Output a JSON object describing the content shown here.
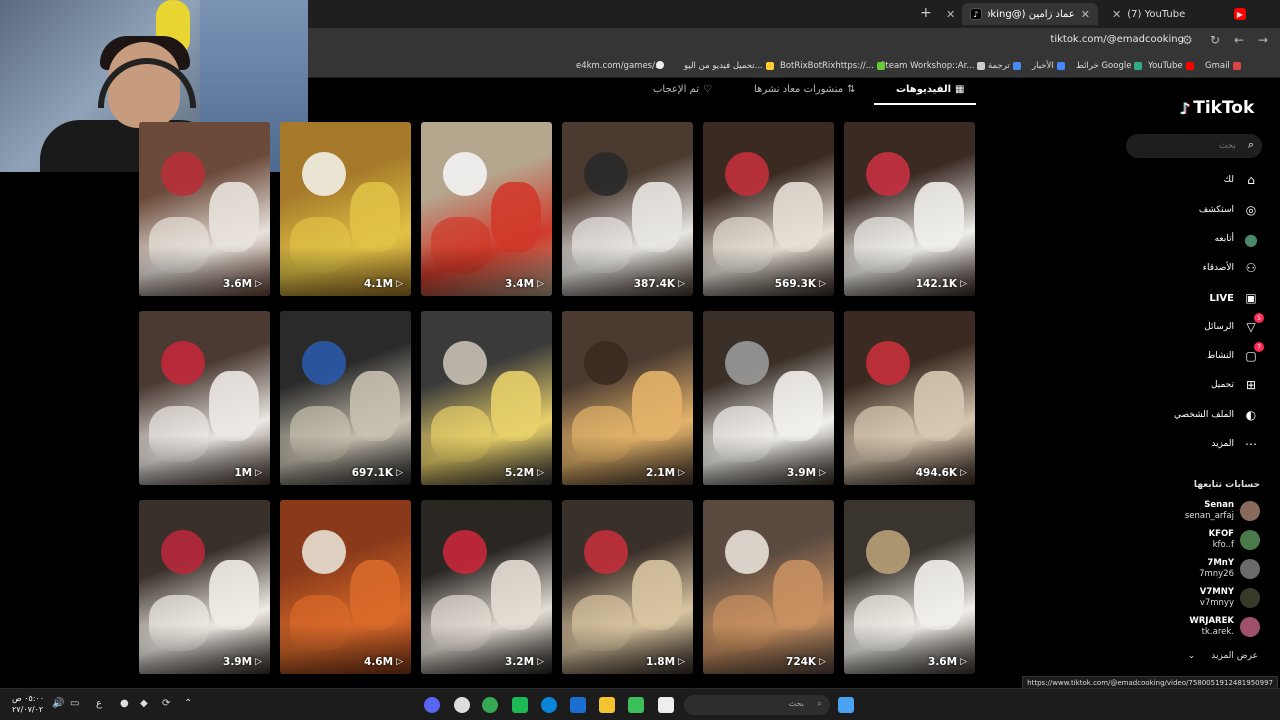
{
  "browser": {
    "tabs": [
      {
        "label": "(7) YouTube",
        "favicon_color": "#ff0000",
        "active": false
      },
      {
        "label": "عماد زامين (@emadcooking)",
        "favicon_color": "#000000",
        "active": true
      }
    ],
    "url": "tiktok.com/@emadcooking",
    "bookmarks": [
      "Gmail",
      "YouTube",
      "خرائط Google",
      "الأخبار",
      "ترجمة",
      "Steam Workshop::Ar...",
      "BotRixBotRixhttps://...",
      "تحميل فيديو من اليو...",
      "e4km.com/games/..."
    ]
  },
  "video_tabs": [
    {
      "label": "الفيديوهات",
      "icon": "grid-icon",
      "active": true
    },
    {
      "label": "منشورات معاد نشرها",
      "icon": "repost-icon",
      "active": false
    },
    {
      "label": "تم الإعجاب",
      "icon": "heart-icon",
      "active": false
    }
  ],
  "videos": [
    {
      "views": "3.6M",
      "c1": "#6b4a3a",
      "c2": "#e8e2dc",
      "c3": "#b8303a"
    },
    {
      "views": "4.1M",
      "c1": "#a67a2a",
      "c2": "#e0c246",
      "c3": "#f2efe6"
    },
    {
      "views": "3.4M",
      "c1": "#b5a68e",
      "c2": "#d03a2a",
      "c3": "#f4f4f4"
    },
    {
      "views": "387.4K",
      "c1": "#4a3a30",
      "c2": "#e8e6e2",
      "c3": "#2a2a2a"
    },
    {
      "views": "569.3K",
      "c1": "#3a2a22",
      "c2": "#e6dfd6",
      "c3": "#c2303a"
    },
    {
      "views": "142.1K",
      "c1": "#3a2a24",
      "c2": "#f0eeea",
      "c3": "#c63040"
    },
    {
      "views": "1M",
      "c1": "#4a3a32",
      "c2": "#ece8e4",
      "c3": "#c2283a"
    },
    {
      "views": "697.1K",
      "c1": "#2a2a2a",
      "c2": "#c8c0b0",
      "c3": "#2a5aa8"
    },
    {
      "views": "5.2M",
      "c1": "#3a3a3a",
      "c2": "#e8d06a",
      "c3": "#c8c0b4"
    },
    {
      "views": "2.1M",
      "c1": "#4a3a30",
      "c2": "#e3b36a",
      "c3": "#3a2a20"
    },
    {
      "views": "3.9M",
      "c1": "#3a3028",
      "c2": "#f2f0ec",
      "c3": "#9a9a9a"
    },
    {
      "views": "494.6K",
      "c1": "#3a2a22",
      "c2": "#d8c8b0",
      "c3": "#c8303a"
    },
    {
      "views": "3.9M",
      "c1": "#3a302a",
      "c2": "#f0ece6",
      "c3": "#b8283a"
    },
    {
      "views": "4.6M",
      "c1": "#8a3a1a",
      "c2": "#d86a2a",
      "c3": "#e8e0d4"
    },
    {
      "views": "3.2M",
      "c1": "#2a2622",
      "c2": "#e4ddd4",
      "c3": "#c8283a"
    },
    {
      "views": "1.8M",
      "c1": "#3a302a",
      "c2": "#d8c4a0",
      "c3": "#c2303a"
    },
    {
      "views": "724K",
      "c1": "#5a4a40",
      "c2": "#c89060",
      "c3": "#e8e0d8"
    },
    {
      "views": "3.6M",
      "c1": "#3a342e",
      "c2": "#f2efea",
      "c3": "#b8a078"
    }
  ],
  "sidebar": {
    "logo": "TikTok",
    "search_placeholder": "بحث",
    "items": [
      {
        "label": "لك",
        "icon": "home-icon"
      },
      {
        "label": "استكشف",
        "icon": "compass-icon"
      },
      {
        "label": "أتابعه",
        "icon": "following-avatar-icon"
      },
      {
        "label": "الأصدقاء",
        "icon": "friends-icon"
      },
      {
        "label": "LIVE",
        "icon": "live-icon"
      },
      {
        "label": "الرسائل",
        "icon": "messages-icon",
        "badge": "5"
      },
      {
        "label": "النشاط",
        "icon": "activity-icon",
        "badge": "7"
      },
      {
        "label": "تحميل",
        "icon": "upload-icon"
      },
      {
        "label": "الملف الشخصي",
        "icon": "profile-icon"
      },
      {
        "label": "المزيد",
        "icon": "more-icon"
      }
    ],
    "following_title": "حسابات تتابعها",
    "accounts": [
      {
        "name": "Senan",
        "handle": "senan_arfaj",
        "color": "#8a6a5a"
      },
      {
        "name": "KFOF",
        "handle": "kfo..f",
        "color": "#4a7a4a"
      },
      {
        "name": "7MnY",
        "handle": "7mny26",
        "color": "#6a6a6a"
      },
      {
        "name": "V7MNY",
        "handle": "v7mnyy",
        "color": "#3a3a2a"
      },
      {
        "name": "WRJAREK",
        "handle": "tk.arek.",
        "color": "#a0506a"
      }
    ],
    "see_more": "عرض المزيد"
  },
  "status_url": "https://www.tiktok.com/@emadcooking/video/7580051912481950997",
  "taskbar": {
    "time": "٠٥:٠٠ ص",
    "date": "٢٧/٠٧/٠٢",
    "search_placeholder": "بحث",
    "lang": "ع"
  }
}
